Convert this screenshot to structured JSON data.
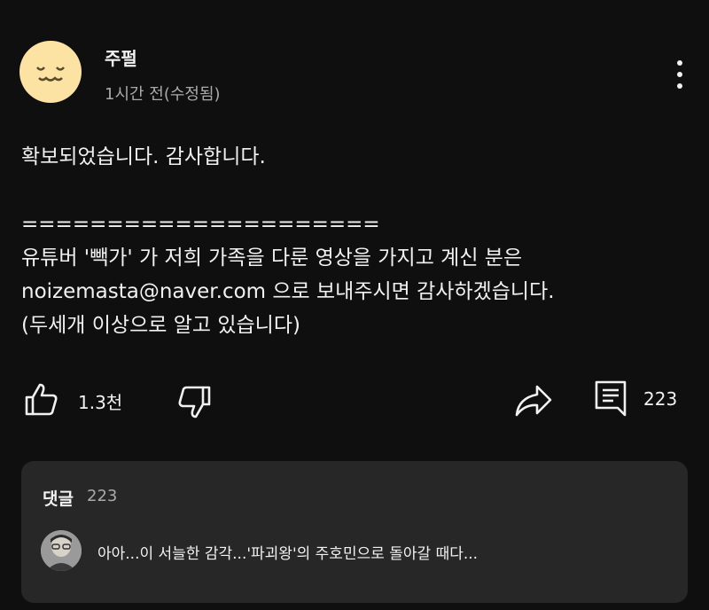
{
  "post": {
    "author": "주펄",
    "time": "1시간 전(수정됨)",
    "body_lines": [
      "확보되었습니다. 감사합니다.",
      "",
      "=====================",
      "유튜버 '빽가' 가 저희 가족을 다룬 영상을 가지고 계신 분은",
      "noizemasta@naver.com 으로 보내주시면 감사하겠습니다.",
      "(두세개 이상으로 알고 있습니다)"
    ]
  },
  "actions": {
    "like_count": "1.3천",
    "comment_count": "223",
    "icons": [
      "thumb-up-icon",
      "thumb-down-icon",
      "share-icon",
      "comment-icon",
      "more-vert-icon"
    ]
  },
  "comments": {
    "title": "댓글",
    "count": "223",
    "preview_text": "아아...이 서늘한 감각...'파괴왕'의 주호민으로 돌아갈 때다..."
  },
  "colors": {
    "background": "#0f0f0f",
    "panel": "#272727",
    "text": "#f1f1f1",
    "muted": "#aaaaaa",
    "avatar": "#fce3a3"
  }
}
